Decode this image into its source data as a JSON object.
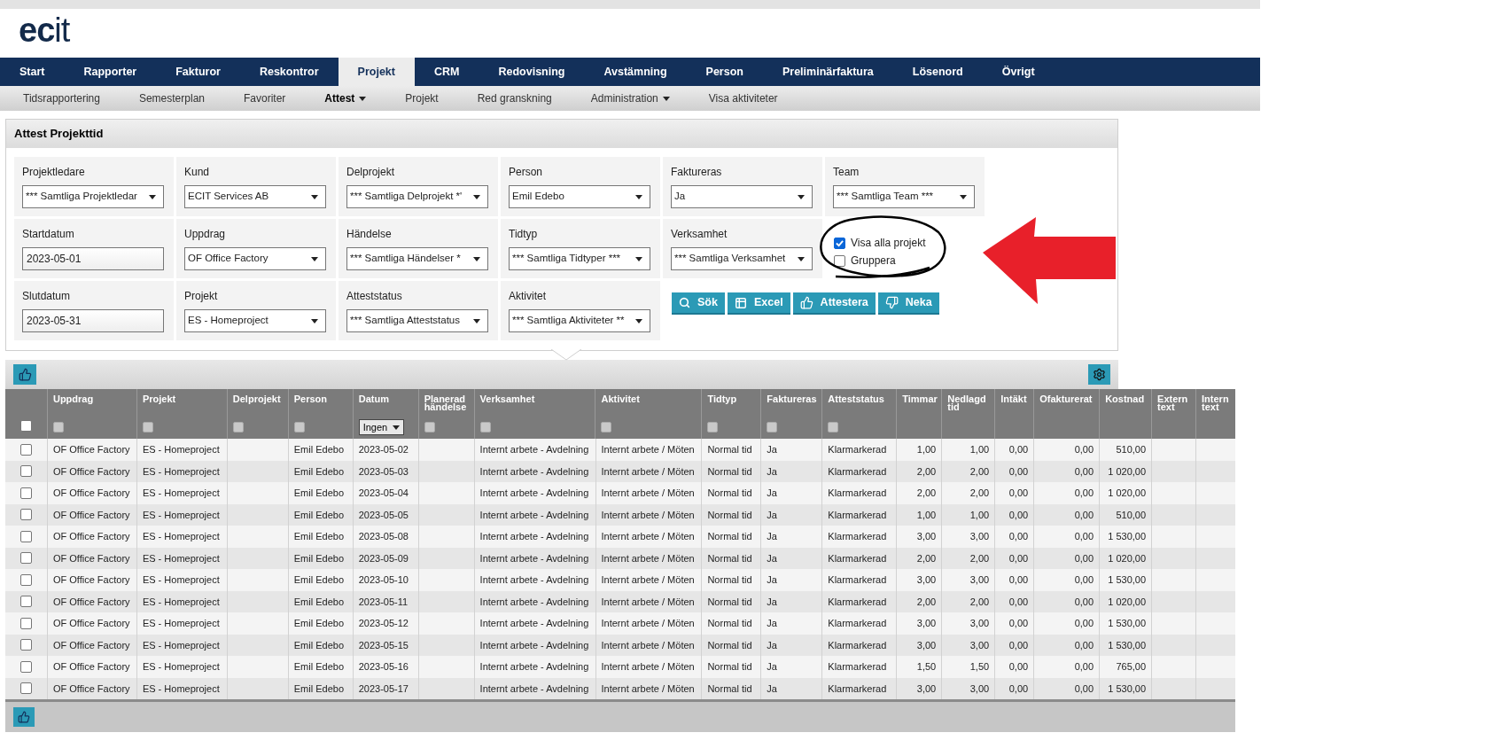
{
  "logo": {
    "bold": "ec",
    "light": "it"
  },
  "nav": [
    {
      "label": "Start",
      "selected": false
    },
    {
      "label": "Rapporter",
      "selected": false
    },
    {
      "label": "Fakturor",
      "selected": false
    },
    {
      "label": "Reskontror",
      "selected": false
    },
    {
      "label": "Projekt",
      "selected": true
    },
    {
      "label": "CRM",
      "selected": false
    },
    {
      "label": "Redovisning",
      "selected": false
    },
    {
      "label": "Avstämning",
      "selected": false
    },
    {
      "label": "Person",
      "selected": false
    },
    {
      "label": "Preliminärfaktura",
      "selected": false
    },
    {
      "label": "Lösenord",
      "selected": false
    },
    {
      "label": "Övrigt",
      "selected": false
    }
  ],
  "subnav": [
    {
      "label": "Tidsrapportering",
      "selected": false,
      "dropdown": false
    },
    {
      "label": "Semesterplan",
      "selected": false,
      "dropdown": false
    },
    {
      "label": "Favoriter",
      "selected": false,
      "dropdown": false
    },
    {
      "label": "Attest",
      "selected": true,
      "dropdown": true
    },
    {
      "label": "Projekt",
      "selected": false,
      "dropdown": false
    },
    {
      "label": "Red granskning",
      "selected": false,
      "dropdown": false
    },
    {
      "label": "Administration",
      "selected": false,
      "dropdown": true
    },
    {
      "label": "Visa aktiviteter",
      "selected": false,
      "dropdown": false
    }
  ],
  "panel_title": "Attest Projekttid",
  "filters": [
    [
      {
        "label": "Projektledare",
        "kind": "select",
        "value": "*** Samtliga Projektledar"
      },
      {
        "label": "Kund",
        "kind": "select",
        "value": "ECIT Services AB"
      },
      {
        "label": "Delprojekt",
        "kind": "select",
        "value": "*** Samtliga Delprojekt *'"
      },
      {
        "label": "Person",
        "kind": "select",
        "value": "Emil Edebo"
      },
      {
        "label": "Faktureras",
        "kind": "select",
        "value": "Ja"
      },
      {
        "label": "Team",
        "kind": "select",
        "value": "*** Samtliga Team ***"
      }
    ],
    [
      {
        "label": "Startdatum",
        "kind": "date",
        "value": "2023-05-01"
      },
      {
        "label": "Uppdrag",
        "kind": "select",
        "value": "OF Office Factory"
      },
      {
        "label": "Händelse",
        "kind": "select",
        "value": "*** Samtliga Händelser *"
      },
      {
        "label": "Tidtyp",
        "kind": "select",
        "value": "*** Samtliga Tidtyper ***"
      },
      {
        "label": "Verksamhet",
        "kind": "select",
        "value": "*** Samtliga Verksamhet"
      }
    ],
    [
      {
        "label": "Slutdatum",
        "kind": "date",
        "value": "2023-05-31"
      },
      {
        "label": "Projekt",
        "kind": "select",
        "value": "ES - Homeproject"
      },
      {
        "label": "Atteststatus",
        "kind": "select",
        "value": "*** Samtliga Atteststatus"
      },
      {
        "label": "Aktivitet",
        "kind": "select",
        "value": "*** Samtliga Aktiviteter **"
      }
    ]
  ],
  "options": [
    {
      "label": "Visa alla projekt",
      "checked": true
    },
    {
      "label": "Gruppera",
      "checked": false
    }
  ],
  "buttons": [
    {
      "label": "Sök",
      "kind": "search"
    },
    {
      "label": "Excel",
      "kind": "excel"
    },
    {
      "label": "Attestera",
      "kind": "approve"
    },
    {
      "label": "Neka",
      "kind": "deny"
    }
  ],
  "table": {
    "select_all": {
      "checked": false
    },
    "columns": [
      {
        "label": "Uppdrag",
        "filter": {
          "kind": "checkbox",
          "checked": false
        },
        "kind": "text"
      },
      {
        "label": "Projekt",
        "filter": {
          "kind": "checkbox",
          "checked": false
        },
        "kind": "text"
      },
      {
        "label": "Delprojekt",
        "filter": {
          "kind": "checkbox",
          "checked": false
        },
        "kind": "text"
      },
      {
        "label": "Person",
        "filter": {
          "kind": "checkbox",
          "checked": false
        },
        "kind": "text"
      },
      {
        "label": "Datum",
        "filter": {
          "kind": "select",
          "value": "Ingen"
        },
        "kind": "text"
      },
      {
        "label": "Planerad händelse",
        "filter": {
          "kind": "checkbox",
          "checked": false
        },
        "kind": "text"
      },
      {
        "label": "Verksamhet",
        "filter": {
          "kind": "checkbox",
          "checked": false
        },
        "kind": "text"
      },
      {
        "label": "Aktivitet",
        "filter": {
          "kind": "checkbox",
          "checked": false
        },
        "kind": "text"
      },
      {
        "label": "Tidtyp",
        "filter": {
          "kind": "checkbox",
          "checked": false
        },
        "kind": "text"
      },
      {
        "label": "Faktureras",
        "filter": {
          "kind": "checkbox",
          "checked": false
        },
        "kind": "text"
      },
      {
        "label": "Atteststatus",
        "filter": {
          "kind": "checkbox",
          "checked": false
        },
        "kind": "text"
      },
      {
        "label": "Timmar",
        "kind": "number"
      },
      {
        "label": "Nedlagd tid",
        "kind": "number"
      },
      {
        "label": "Intäkt",
        "kind": "number"
      },
      {
        "label": "Ofakturerat",
        "kind": "number"
      },
      {
        "label": "Kostnad",
        "kind": "number"
      },
      {
        "label": "Extern text",
        "kind": "text"
      },
      {
        "label": "Intern text",
        "kind": "text"
      }
    ],
    "rows": [
      {
        "checked": false,
        "cells": [
          "OF Office Factory",
          "ES - Homeproject",
          "",
          "Emil Edebo",
          "2023-05-02",
          "",
          "Internt arbete - Avdelning",
          "Internt arbete / Möten",
          "Normal tid",
          "Ja",
          "Klarmarkerad",
          "1,00",
          "1,00",
          "0,00",
          "0,00",
          "510,00",
          "",
          ""
        ]
      },
      {
        "checked": false,
        "cells": [
          "OF Office Factory",
          "ES - Homeproject",
          "",
          "Emil Edebo",
          "2023-05-03",
          "",
          "Internt arbete - Avdelning",
          "Internt arbete / Möten",
          "Normal tid",
          "Ja",
          "Klarmarkerad",
          "2,00",
          "2,00",
          "0,00",
          "0,00",
          "1 020,00",
          "",
          ""
        ]
      },
      {
        "checked": false,
        "cells": [
          "OF Office Factory",
          "ES - Homeproject",
          "",
          "Emil Edebo",
          "2023-05-04",
          "",
          "Internt arbete - Avdelning",
          "Internt arbete / Möten",
          "Normal tid",
          "Ja",
          "Klarmarkerad",
          "2,00",
          "2,00",
          "0,00",
          "0,00",
          "1 020,00",
          "",
          ""
        ]
      },
      {
        "checked": false,
        "cells": [
          "OF Office Factory",
          "ES - Homeproject",
          "",
          "Emil Edebo",
          "2023-05-05",
          "",
          "Internt arbete - Avdelning",
          "Internt arbete / Möten",
          "Normal tid",
          "Ja",
          "Klarmarkerad",
          "1,00",
          "1,00",
          "0,00",
          "0,00",
          "510,00",
          "",
          ""
        ]
      },
      {
        "checked": false,
        "cells": [
          "OF Office Factory",
          "ES - Homeproject",
          "",
          "Emil Edebo",
          "2023-05-08",
          "",
          "Internt arbete - Avdelning",
          "Internt arbete / Möten",
          "Normal tid",
          "Ja",
          "Klarmarkerad",
          "3,00",
          "3,00",
          "0,00",
          "0,00",
          "1 530,00",
          "",
          ""
        ]
      },
      {
        "checked": false,
        "cells": [
          "OF Office Factory",
          "ES - Homeproject",
          "",
          "Emil Edebo",
          "2023-05-09",
          "",
          "Internt arbete - Avdelning",
          "Internt arbete / Möten",
          "Normal tid",
          "Ja",
          "Klarmarkerad",
          "2,00",
          "2,00",
          "0,00",
          "0,00",
          "1 020,00",
          "",
          ""
        ]
      },
      {
        "checked": false,
        "cells": [
          "OF Office Factory",
          "ES - Homeproject",
          "",
          "Emil Edebo",
          "2023-05-10",
          "",
          "Internt arbete - Avdelning",
          "Internt arbete / Möten",
          "Normal tid",
          "Ja",
          "Klarmarkerad",
          "3,00",
          "3,00",
          "0,00",
          "0,00",
          "1 530,00",
          "",
          ""
        ]
      },
      {
        "checked": false,
        "cells": [
          "OF Office Factory",
          "ES - Homeproject",
          "",
          "Emil Edebo",
          "2023-05-11",
          "",
          "Internt arbete - Avdelning",
          "Internt arbete / Möten",
          "Normal tid",
          "Ja",
          "Klarmarkerad",
          "2,00",
          "2,00",
          "0,00",
          "0,00",
          "1 020,00",
          "",
          ""
        ]
      },
      {
        "checked": false,
        "cells": [
          "OF Office Factory",
          "ES - Homeproject",
          "",
          "Emil Edebo",
          "2023-05-12",
          "",
          "Internt arbete - Avdelning",
          "Internt arbete / Möten",
          "Normal tid",
          "Ja",
          "Klarmarkerad",
          "3,00",
          "3,00",
          "0,00",
          "0,00",
          "1 530,00",
          "",
          ""
        ]
      },
      {
        "checked": false,
        "cells": [
          "OF Office Factory",
          "ES - Homeproject",
          "",
          "Emil Edebo",
          "2023-05-15",
          "",
          "Internt arbete - Avdelning",
          "Internt arbete / Möten",
          "Normal tid",
          "Ja",
          "Klarmarkerad",
          "3,00",
          "3,00",
          "0,00",
          "0,00",
          "1 530,00",
          "",
          ""
        ]
      },
      {
        "checked": false,
        "cells": [
          "OF Office Factory",
          "ES - Homeproject",
          "",
          "Emil Edebo",
          "2023-05-16",
          "",
          "Internt arbete - Avdelning",
          "Internt arbete / Möten",
          "Normal tid",
          "Ja",
          "Klarmarkerad",
          "1,50",
          "1,50",
          "0,00",
          "0,00",
          "765,00",
          "",
          ""
        ]
      },
      {
        "checked": false,
        "cells": [
          "OF Office Factory",
          "ES - Homeproject",
          "",
          "Emil Edebo",
          "2023-05-17",
          "",
          "Internt arbete - Avdelning",
          "Internt arbete / Möten",
          "Normal tid",
          "Ja",
          "Klarmarkerad",
          "3,00",
          "3,00",
          "0,00",
          "0,00",
          "1 530,00",
          "",
          ""
        ]
      }
    ]
  }
}
